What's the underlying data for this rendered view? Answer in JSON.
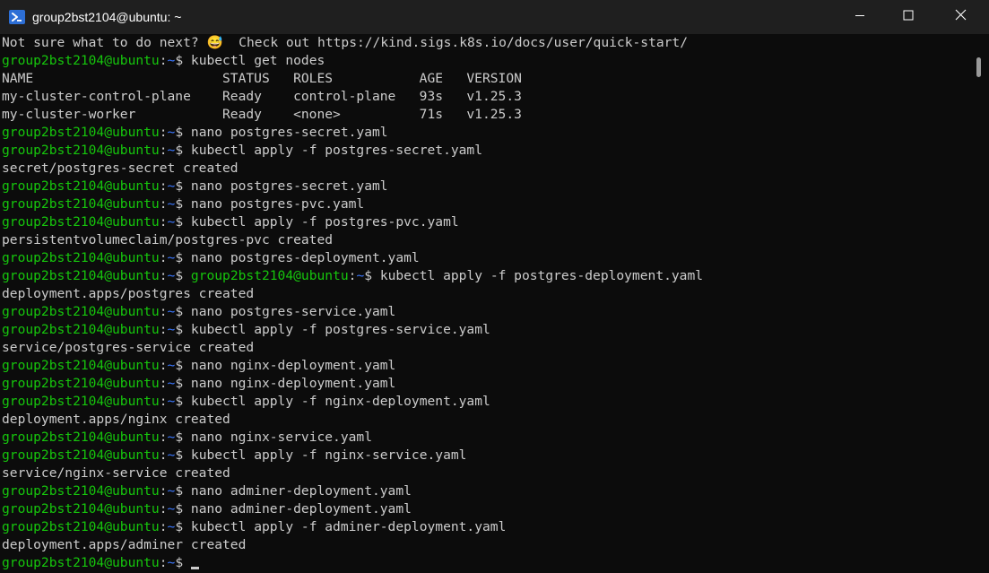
{
  "window": {
    "title": "group2bst2104@ubuntu: ~",
    "minimize_label": "Minimize",
    "maximize_label": "Maximize",
    "close_label": "Close"
  },
  "prompt": {
    "user_host": "group2bst2104@ubuntu",
    "colon": ":",
    "path": "~",
    "dollar": "$ "
  },
  "terminal": {
    "lines": [
      {
        "type": "output",
        "text": "Not sure what to do next? 😅  Check out https://kind.sigs.k8s.io/docs/user/quick-start/"
      },
      {
        "type": "prompt",
        "cmd": "kubectl get nodes"
      },
      {
        "type": "output",
        "text": "NAME                        STATUS   ROLES           AGE   VERSION"
      },
      {
        "type": "output",
        "text": "my-cluster-control-plane    Ready    control-plane   93s   v1.25.3"
      },
      {
        "type": "output",
        "text": "my-cluster-worker           Ready    <none>          71s   v1.25.3"
      },
      {
        "type": "prompt",
        "cmd": "nano postgres-secret.yaml"
      },
      {
        "type": "prompt",
        "cmd": "kubectl apply -f postgres-secret.yaml"
      },
      {
        "type": "output",
        "text": "secret/postgres-secret created"
      },
      {
        "type": "prompt",
        "cmd": "nano postgres-secret.yaml"
      },
      {
        "type": "prompt",
        "cmd": "nano postgres-pvc.yaml"
      },
      {
        "type": "prompt",
        "cmd": "kubectl apply -f postgres-pvc.yaml"
      },
      {
        "type": "output",
        "text": "persistentvolumeclaim/postgres-pvc created"
      },
      {
        "type": "prompt",
        "cmd": "nano postgres-deployment.yaml"
      },
      {
        "type": "double_prompt",
        "cmd": "kubectl apply -f postgres-deployment.yaml"
      },
      {
        "type": "output",
        "text": "deployment.apps/postgres created"
      },
      {
        "type": "prompt",
        "cmd": "nano postgres-service.yaml"
      },
      {
        "type": "prompt",
        "cmd": "kubectl apply -f postgres-service.yaml"
      },
      {
        "type": "output",
        "text": "service/postgres-service created"
      },
      {
        "type": "prompt",
        "cmd": "nano nginx-deployment.yaml"
      },
      {
        "type": "prompt",
        "cmd": "nano nginx-deployment.yaml"
      },
      {
        "type": "prompt",
        "cmd": "kubectl apply -f nginx-deployment.yaml"
      },
      {
        "type": "output",
        "text": "deployment.apps/nginx created"
      },
      {
        "type": "prompt",
        "cmd": "nano nginx-service.yaml"
      },
      {
        "type": "prompt",
        "cmd": "kubectl apply -f nginx-service.yaml"
      },
      {
        "type": "output",
        "text": "service/nginx-service created"
      },
      {
        "type": "prompt",
        "cmd": "nano adminer-deployment.yaml"
      },
      {
        "type": "prompt",
        "cmd": "nano adminer-deployment.yaml"
      },
      {
        "type": "prompt",
        "cmd": "kubectl apply -f adminer-deployment.yaml"
      },
      {
        "type": "output",
        "text": "deployment.apps/adminer created"
      },
      {
        "type": "current_prompt",
        "cmd": ""
      }
    ]
  },
  "colors": {
    "background": "#0c0c0c",
    "titlebar": "#1f1f1f",
    "text": "#cccccc",
    "prompt_user": "#16c60c",
    "prompt_path": "#3b78ff"
  },
  "icons": {
    "app": "powershell-icon",
    "minimize": "minimize-icon",
    "maximize": "maximize-icon",
    "close": "close-icon"
  }
}
